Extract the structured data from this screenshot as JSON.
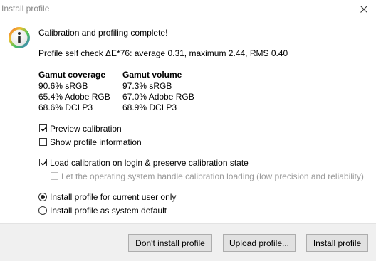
{
  "window": {
    "title": "Install profile"
  },
  "message": {
    "heading": "Calibration and profiling complete!",
    "self_check": "Profile self check ΔE*76: average 0.31, maximum 2.44, RMS 0.40"
  },
  "gamut": {
    "coverage_header": "Gamut coverage",
    "volume_header": "Gamut volume",
    "coverage": [
      "90.6% sRGB",
      "65.4% Adobe RGB",
      "68.6% DCI P3"
    ],
    "volume": [
      "97.3% sRGB",
      "67.0% Adobe RGB",
      "68.9% DCI P3"
    ]
  },
  "options": {
    "preview_calibration": {
      "label": "Preview calibration",
      "checked": true
    },
    "show_profile_info": {
      "label": "Show profile information",
      "checked": false
    },
    "load_calibration": {
      "label": "Load calibration on login & preserve calibration state",
      "checked": true
    },
    "os_handle_loading": {
      "label": "Let the operating system handle calibration loading (low precision and reliability)",
      "checked": false,
      "enabled": false
    }
  },
  "install_scope": {
    "current_user": {
      "label": "Install profile for current user only",
      "selected": true
    },
    "system_default": {
      "label": "Install profile as system default",
      "selected": false
    }
  },
  "buttons": {
    "dont_install": "Don't install profile",
    "upload": "Upload profile...",
    "install": "Install profile"
  },
  "icons": {
    "info": "info-icon",
    "close": "close-icon",
    "check": "checkmark-icon"
  },
  "colors": {
    "title_text": "#888888",
    "footer_bg": "#f0f0f0",
    "button_bg": "#e1e1e1",
    "button_border": "#adadad"
  }
}
